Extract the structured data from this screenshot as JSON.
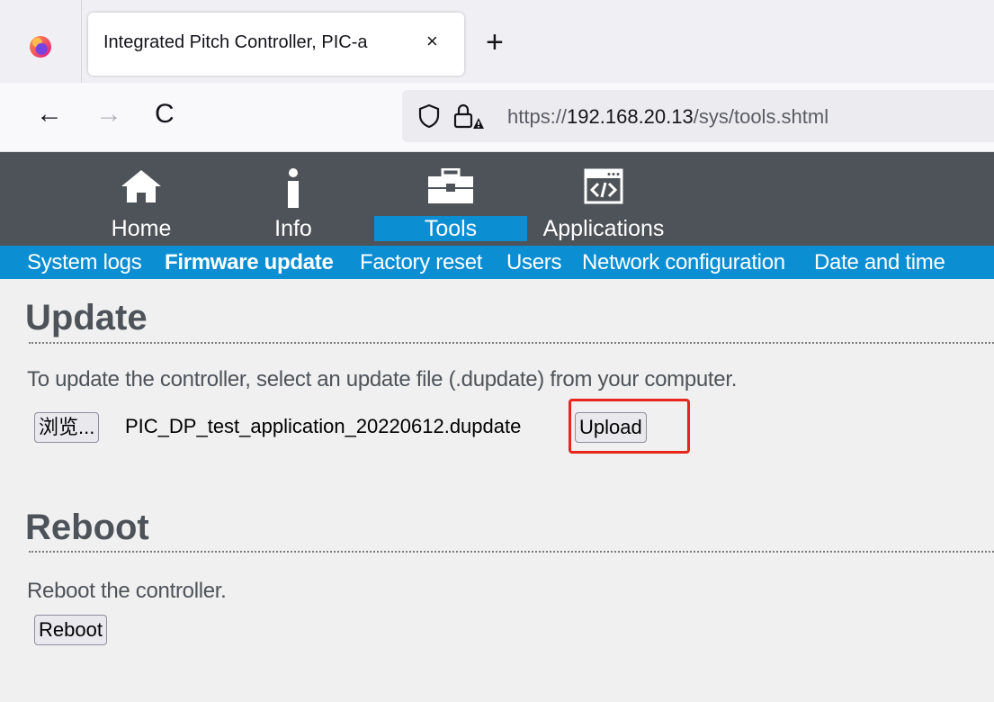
{
  "browser": {
    "tab_title": "Integrated Pitch Controller, PIC-a",
    "tab_close": "×",
    "new_tab": "+",
    "back": "←",
    "forward": "→",
    "reload": "C",
    "url_scheme": "https://",
    "url_host": "192.168.20.13",
    "url_path": "/sys/tools.shtml"
  },
  "header": {
    "tabs": [
      {
        "label": "Home",
        "icon": "home-icon"
      },
      {
        "label": "Info",
        "icon": "info-icon"
      },
      {
        "label": "Tools",
        "icon": "toolbox-icon",
        "active": true
      },
      {
        "label": "Applications",
        "icon": "code-window-icon"
      }
    ],
    "subnav": [
      {
        "label": "System logs"
      },
      {
        "label": "Firmware update",
        "active": true
      },
      {
        "label": "Factory reset"
      },
      {
        "label": "Users"
      },
      {
        "label": "Network configuration"
      },
      {
        "label": "Date and time"
      }
    ]
  },
  "update": {
    "title": "Update",
    "description": "To update the controller, select an update file (.dupdate) from your computer.",
    "browse_label": "浏览...",
    "selected_file": "PIC_DP_test_application_20220612.dupdate",
    "upload_label": "Upload"
  },
  "reboot": {
    "title": "Reboot",
    "description": "Reboot the controller.",
    "reboot_label": "Reboot"
  },
  "colors": {
    "header_bg": "#4e5359",
    "accent_blue": "#0c8ed3",
    "highlight_red": "#e8261c"
  }
}
